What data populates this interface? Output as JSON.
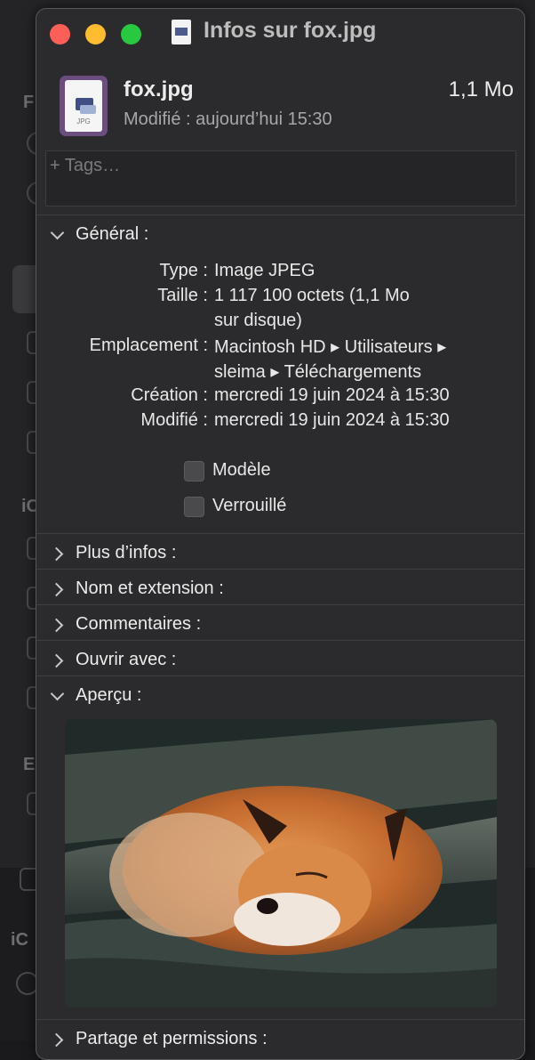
{
  "window": {
    "title": "Infos sur fox.jpg",
    "close_color": "#fe5f57",
    "minimize_color": "#febc2e",
    "maximize_color": "#28c840"
  },
  "file": {
    "icon": "jpg-file-icon",
    "icon_label": "JPG",
    "name": "fox.jpg",
    "size": "1,1 Mo",
    "modified_label": "Modifié :",
    "modified_value": "aujourd’hui 15:30"
  },
  "tags": {
    "placeholder": "+ Tags…"
  },
  "general": {
    "label": "Général :",
    "expanded": true,
    "rows": [
      {
        "key": "Type :",
        "value": "Image JPEG"
      },
      {
        "key": "Taille :",
        "value": "1 117 100 octets (1,1 Mo",
        "value2": "sur disque)"
      },
      {
        "key": "Emplacement :",
        "value": "Macintosh HD ▸ Utilisateurs ▸",
        "value2": "sleima ▸ Téléchargements"
      },
      {
        "key": "Création :",
        "value": "mercredi 19 juin 2024 à 15:30"
      },
      {
        "key": "Modifié :",
        "value": "mercredi 19 juin 2024 à 15:30"
      }
    ],
    "checkboxes": [
      {
        "label": "Modèle",
        "checked": false
      },
      {
        "label": "Verrouillé",
        "checked": false
      }
    ]
  },
  "sections": [
    {
      "label": "Plus d’infos :",
      "expanded": false
    },
    {
      "label": "Nom et extension :",
      "expanded": false
    },
    {
      "label": "Commentaires :",
      "expanded": false
    },
    {
      "label": "Ouvrir avec :",
      "expanded": false
    },
    {
      "label": "Aperçu :",
      "expanded": true
    },
    {
      "label": "Partage et permissions :",
      "expanded": false
    }
  ],
  "background": {
    "letters": [
      "F",
      "iC",
      "E",
      "iC"
    ]
  }
}
